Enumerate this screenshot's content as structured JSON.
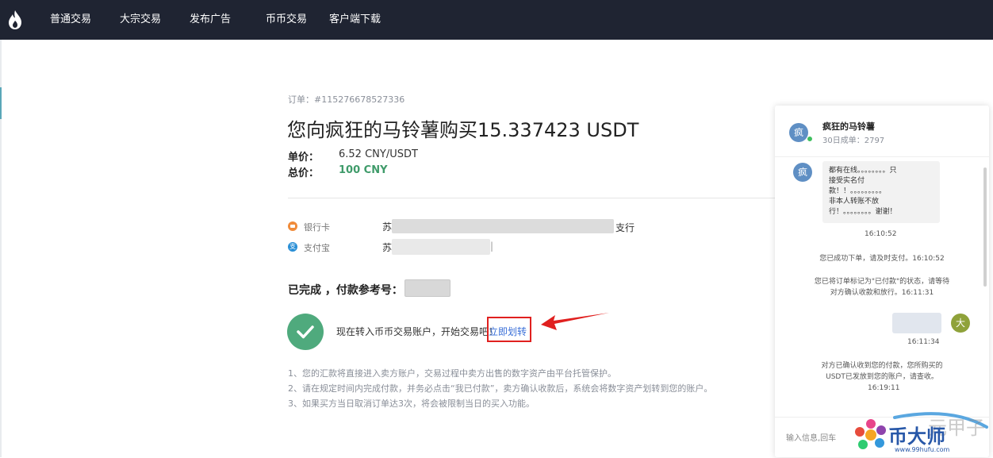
{
  "nav": {
    "items": [
      {
        "label": "普通交易"
      },
      {
        "label": "大宗交易"
      },
      {
        "label": "发布广告"
      },
      {
        "label": "币币交易"
      },
      {
        "label": "客户端下载"
      }
    ]
  },
  "order": {
    "number": "订单：#115276678527336",
    "title": "您向疯狂的马铃薯购买15.337423 USDT",
    "unit_price_label": "单价：",
    "unit_price_value": "6.52 CNY/USDT",
    "total_label": "总价：",
    "total_value": "100 CNY",
    "colors": {
      "total": "#3f9b6a"
    }
  },
  "payment": {
    "bank": {
      "label": "银行卡",
      "lead": "苏",
      "suffix": "支行"
    },
    "alipay": {
      "label": "支付宝",
      "lead": "苏",
      "tail": "|"
    }
  },
  "status": {
    "text": "已完成 ，付款参考号："
  },
  "transfer": {
    "text": "现在转入币币交易账户，开始交易吧！",
    "link": "立即划转"
  },
  "notes": [
    "1、您的汇款将直接进入卖方账户，交易过程中卖方出售的数字资产由平台托管保护。",
    "2、请在规定时间内完成付款，并务必点击“我已付款”，卖方确认收款后，系统会将数字资产划转到您的账户。",
    "3、如果买方当日取消订单达3次，将会被限制当日的买入功能。"
  ],
  "chat": {
    "seller_avatar": "疯",
    "seller_name": "疯狂的马铃薯",
    "seller_stat": "30日成单：2797",
    "messages": {
      "seller_msg_lines": [
        "都有在线。。。。。。。。只",
        "接受实名付",
        "款！！。。。。。。。。。",
        "非本人转账不放",
        "行！。。。。。。。。谢谢！"
      ],
      "seller_msg_time": "16:10:52",
      "sys1": "您已成功下单，请及时支付。16:10:52",
      "sys2_line1": "您已将订单标记为\"已付款\"的状态，请等待",
      "sys2_line2": "对方确认收款和放行。16:11:31",
      "buyer_avatar": "大",
      "buyer_time": "16:11:34",
      "sys3_line1": "对方已确认收到您的付款，您所购买的",
      "sys3_line2": "USDT已发放到您的账户，请查收。",
      "sys3_time": "16:19:11"
    },
    "input_placeholder": "输入信息,回车"
  },
  "watermark": {
    "brand": "币大师",
    "url": "www.99hufu.com",
    "ghost": "元甲子"
  },
  "colors": {
    "nav_bg": "#1f2432",
    "accent_green": "#4faa7d",
    "link_blue": "#3a6fd8",
    "highlight_red": "#e0201f"
  },
  "icons": {
    "logo": "flame-logo-icon",
    "bank": "bank-card-icon",
    "alipay": "alipay-icon",
    "done": "check-icon"
  }
}
